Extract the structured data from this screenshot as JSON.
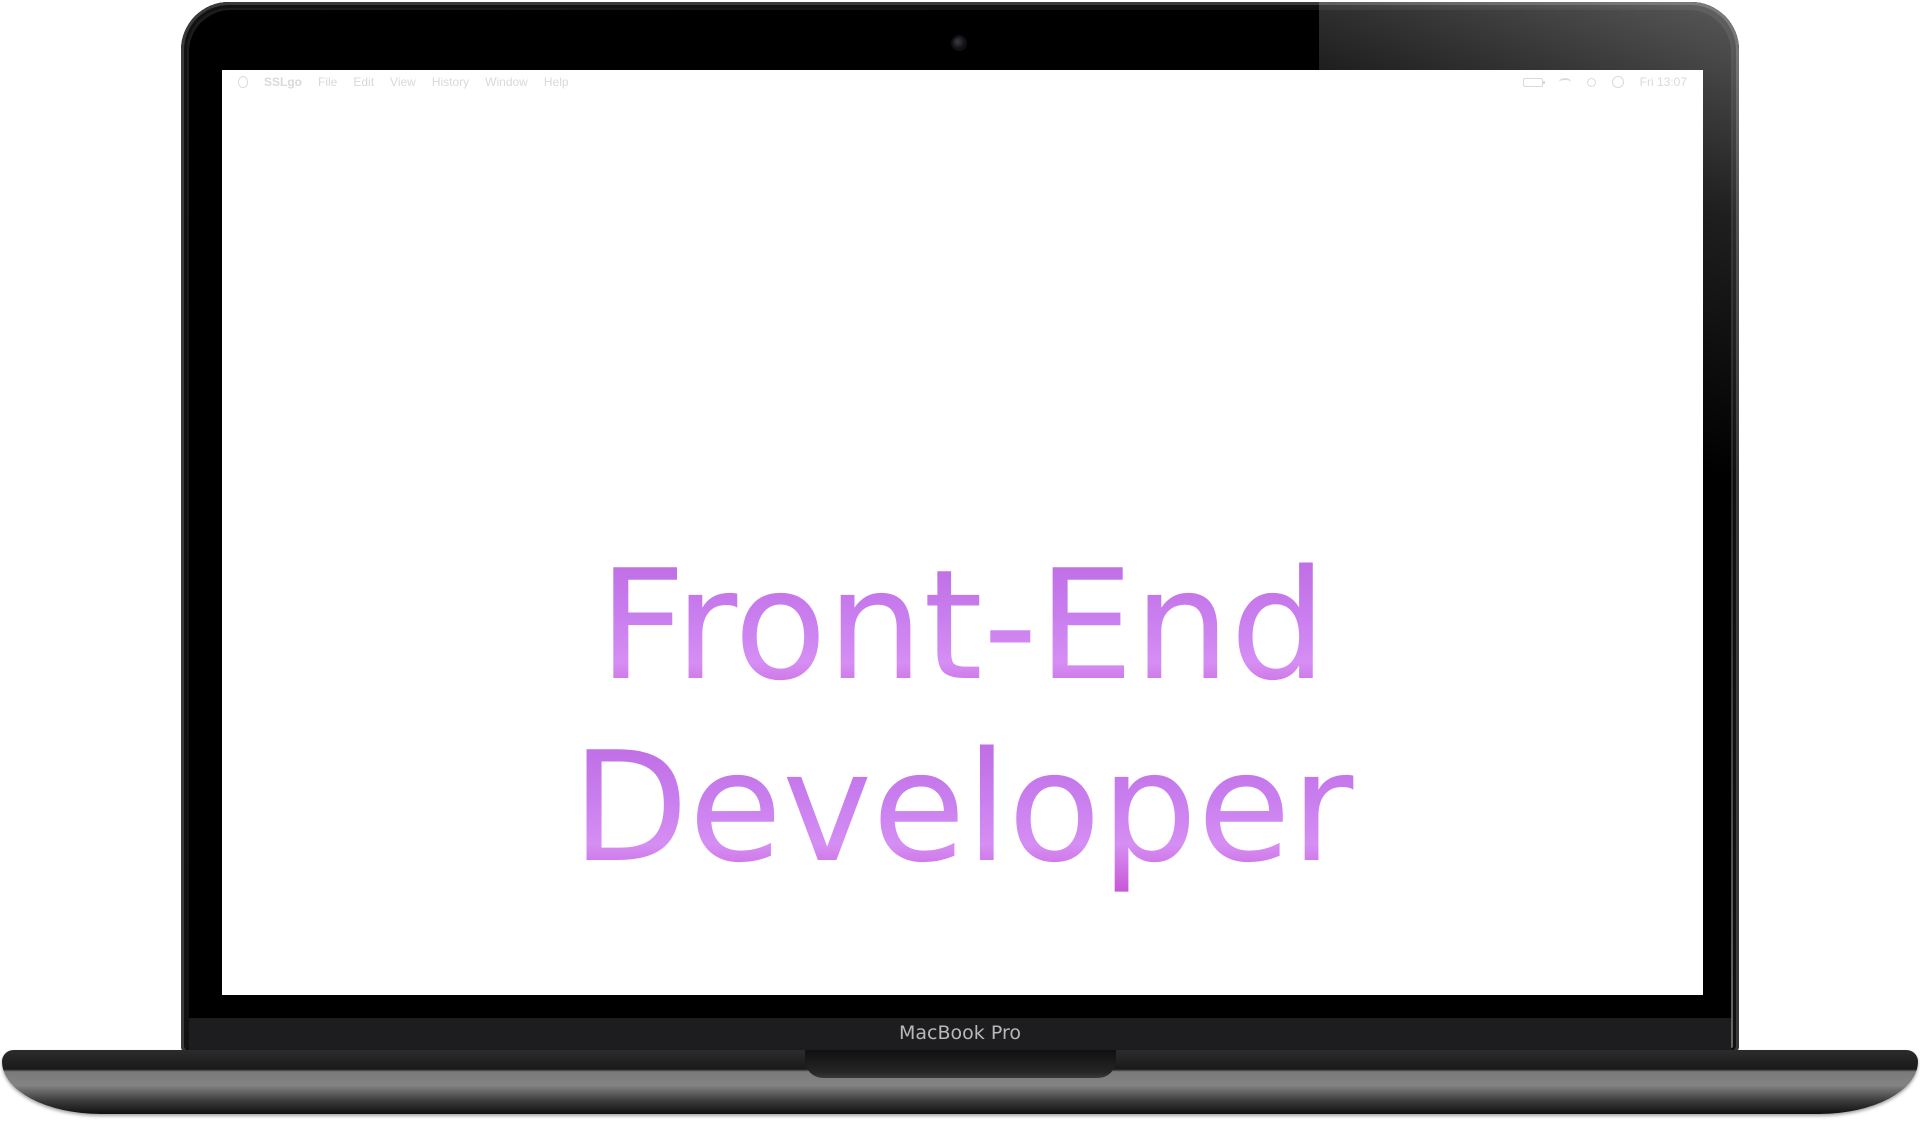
{
  "menubar": {
    "app_name": "SSLgo",
    "items": [
      "File",
      "Edit",
      "View",
      "History",
      "Window",
      "Help"
    ],
    "clock": "Fri 13:07"
  },
  "screen": {
    "headline_line1": "Front-End",
    "headline_line2": "Developer"
  },
  "device": {
    "brand_label": "MacBook Pro"
  },
  "colors": {
    "headline_top": "#bb66e0",
    "headline_bottom": "#c64fd2",
    "bezel": "#000000",
    "base": "#838383"
  }
}
